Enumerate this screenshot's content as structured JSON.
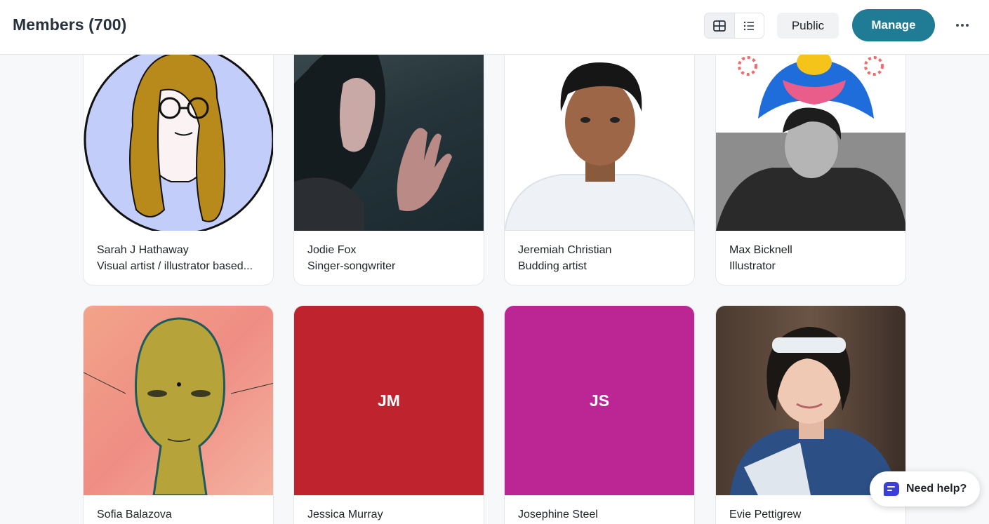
{
  "header": {
    "title": "Members (700)",
    "public_label": "Public",
    "manage_label": "Manage",
    "view_grid_icon": "grid-icon",
    "view_list_icon": "list-icon",
    "more_icon": "more-horizontal-icon"
  },
  "colors": {
    "manage_bg": "#1f7c94",
    "jm_bg": "#be232e",
    "js_bg": "#bb2594",
    "help_icon": "#3b3fd8"
  },
  "members": [
    {
      "name": "Sarah J Hathaway",
      "description": "Visual artist / illustrator based..."
    },
    {
      "name": "Jodie Fox",
      "description": "Singer-songwriter"
    },
    {
      "name": "Jeremiah Christian",
      "description": "Budding artist"
    },
    {
      "name": "Max Bicknell",
      "description": "Illustrator"
    },
    {
      "name": "Sofia Balazova",
      "description": ""
    },
    {
      "name": "Jessica Murray",
      "description": "",
      "initials": "JM"
    },
    {
      "name": "Josephine Steel",
      "description": "",
      "initials": "JS"
    },
    {
      "name": "Evie Pettigrew",
      "description": ""
    }
  ],
  "help": {
    "label": "Need help?",
    "icon": "chat-icon"
  }
}
